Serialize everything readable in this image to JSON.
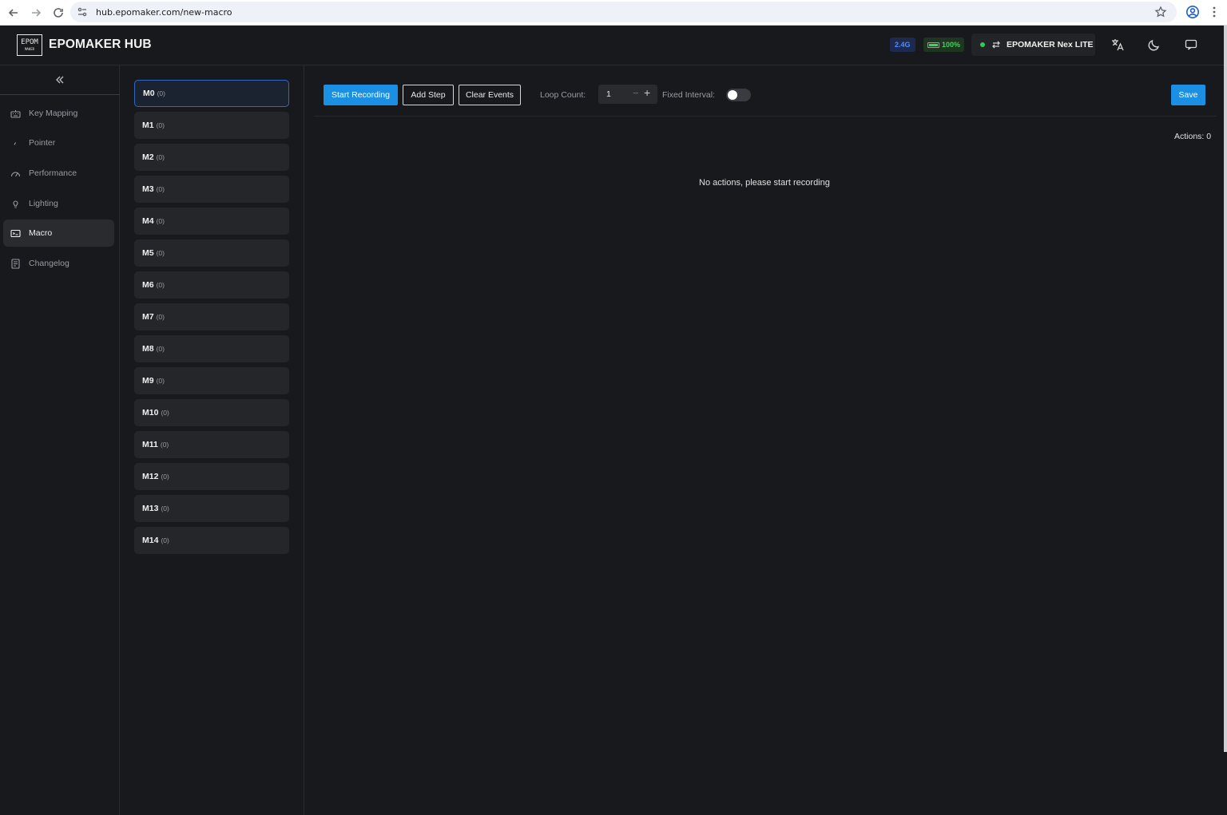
{
  "browser": {
    "url": "hub.epomaker.com/new-macro"
  },
  "header": {
    "logo_line1": "EPOM",
    "logo_line2": "MAKER",
    "title": "EPOMAKER HUB",
    "connection_badge": "2.4G",
    "battery_label": "100%",
    "battery_level": 1.0,
    "device_name": "EPOMAKER Nex LITE"
  },
  "sidebar": {
    "items": [
      {
        "label": "Key Mapping",
        "icon": "keyboard-icon",
        "active": false
      },
      {
        "label": "Pointer",
        "icon": "pointer-icon",
        "active": false
      },
      {
        "label": "Performance",
        "icon": "gauge-icon",
        "active": false
      },
      {
        "label": "Lighting",
        "icon": "bulb-icon",
        "active": false
      },
      {
        "label": "Macro",
        "icon": "macro-icon",
        "active": true
      },
      {
        "label": "Changelog",
        "icon": "document-icon",
        "active": false
      }
    ]
  },
  "macros": [
    {
      "name": "M0",
      "count": "(0)"
    },
    {
      "name": "M1",
      "count": "(0)"
    },
    {
      "name": "M2",
      "count": "(0)"
    },
    {
      "name": "M3",
      "count": "(0)"
    },
    {
      "name": "M4",
      "count": "(0)"
    },
    {
      "name": "M5",
      "count": "(0)"
    },
    {
      "name": "M6",
      "count": "(0)"
    },
    {
      "name": "M7",
      "count": "(0)"
    },
    {
      "name": "M8",
      "count": "(0)"
    },
    {
      "name": "M9",
      "count": "(0)"
    },
    {
      "name": "M10",
      "count": "(0)"
    },
    {
      "name": "M11",
      "count": "(0)"
    },
    {
      "name": "M12",
      "count": "(0)"
    },
    {
      "name": "M13",
      "count": "(0)"
    },
    {
      "name": "M14",
      "count": "(0)"
    }
  ],
  "toolbar": {
    "start_recording": "Start Recording",
    "add_step": "Add Step",
    "clear_events": "Clear Events",
    "loop_count_label": "Loop Count:",
    "loop_count_value": "1",
    "minus": "−",
    "plus": "+",
    "fixed_interval_label": "Fixed Interval:",
    "fixed_interval_on": false,
    "save": "Save"
  },
  "content": {
    "actions_count": "Actions: 0",
    "empty_message": "No actions, please start recording"
  },
  "colors": {
    "accent": "#1a8fe3",
    "background": "#18191c",
    "card": "#252629",
    "online": "#2ecc55"
  }
}
